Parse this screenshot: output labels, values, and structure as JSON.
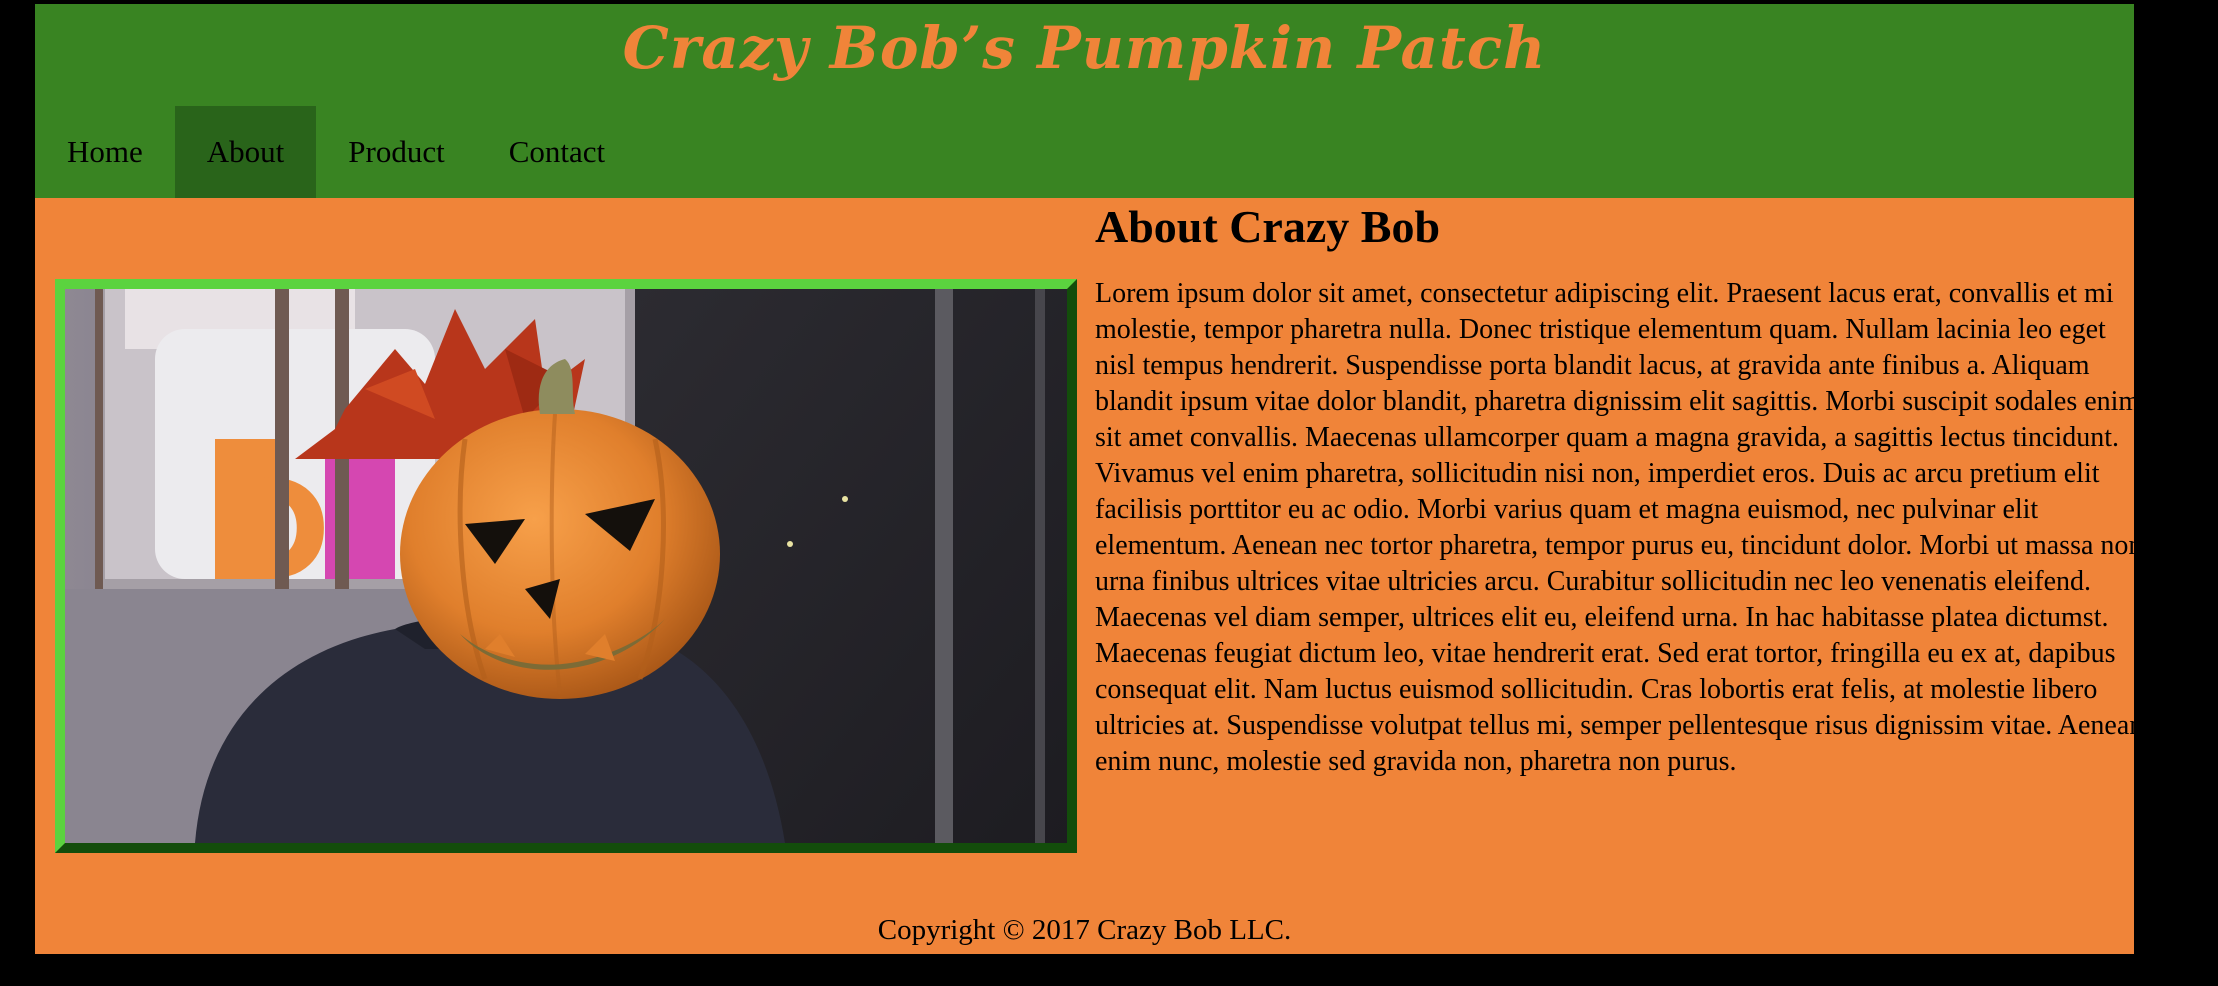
{
  "site": {
    "title": "Crazy Bob’s Pumpkin Patch"
  },
  "nav": {
    "items": [
      {
        "label": "Home"
      },
      {
        "label": "About",
        "active": true
      },
      {
        "label": "Product"
      },
      {
        "label": "Contact"
      }
    ]
  },
  "about": {
    "heading": "About Crazy Bob",
    "body": "Lorem ipsum dolor sit amet, consectetur adipiscing elit. Praesent lacus erat, convallis et mi molestie, tempor pharetra nulla. Donec tristique elementum quam. Nullam lacinia leo eget nisl tempus hendrerit. Suspendisse porta blandit lacus, at gravida ante finibus a. Aliquam blandit ipsum vitae dolor blandit, pharetra dignissim elit sagittis. Morbi suscipit sodales enim sit amet convallis. Maecenas ullamcorper quam a magna gravida, a sagittis lectus tincidunt. Vivamus vel enim pharetra, sollicitudin nisi non, imperdiet eros. Duis ac arcu pretium elit facilisis porttitor eu ac odio. Morbi varius quam et magna euismod, nec pulvinar elit elementum. Aenean nec tortor pharetra, tempor purus eu, tincidunt dolor. Morbi ut massa non urna finibus ultrices vitae ultricies arcu. Curabitur sollicitudin nec leo venenatis eleifend. Maecenas vel diam semper, ultrices elit eu, eleifend urna. In hac habitasse platea dictumst. Maecenas feugiat dictum leo, vitae hendrerit erat. Sed erat tortor, fringilla eu ex at, dapibus consequat elit. Nam luctus euismod sollicitudin. Cras lobortis erat felis, at molestie libero ultricies at. Suspendisse volutpat tellus mi, semper pellentesque risus dignissim vitae. Aenean enim nunc, molestie sed gravida non, pharetra non purus."
  },
  "photo": {
    "icon": "pumpkin-head-photo",
    "sign_letters": "D"
  },
  "footer": {
    "copyright": "Copyright © 2017 Crazy Bob LLC."
  },
  "colors": {
    "header_green": "#398422",
    "active_nav_green": "#29641a",
    "page_orange": "#f08439",
    "title_orange": "#f08439",
    "photo_border_light": "#5bd33f",
    "photo_border_dark": "#134d0b",
    "outer_background": "#000000"
  }
}
